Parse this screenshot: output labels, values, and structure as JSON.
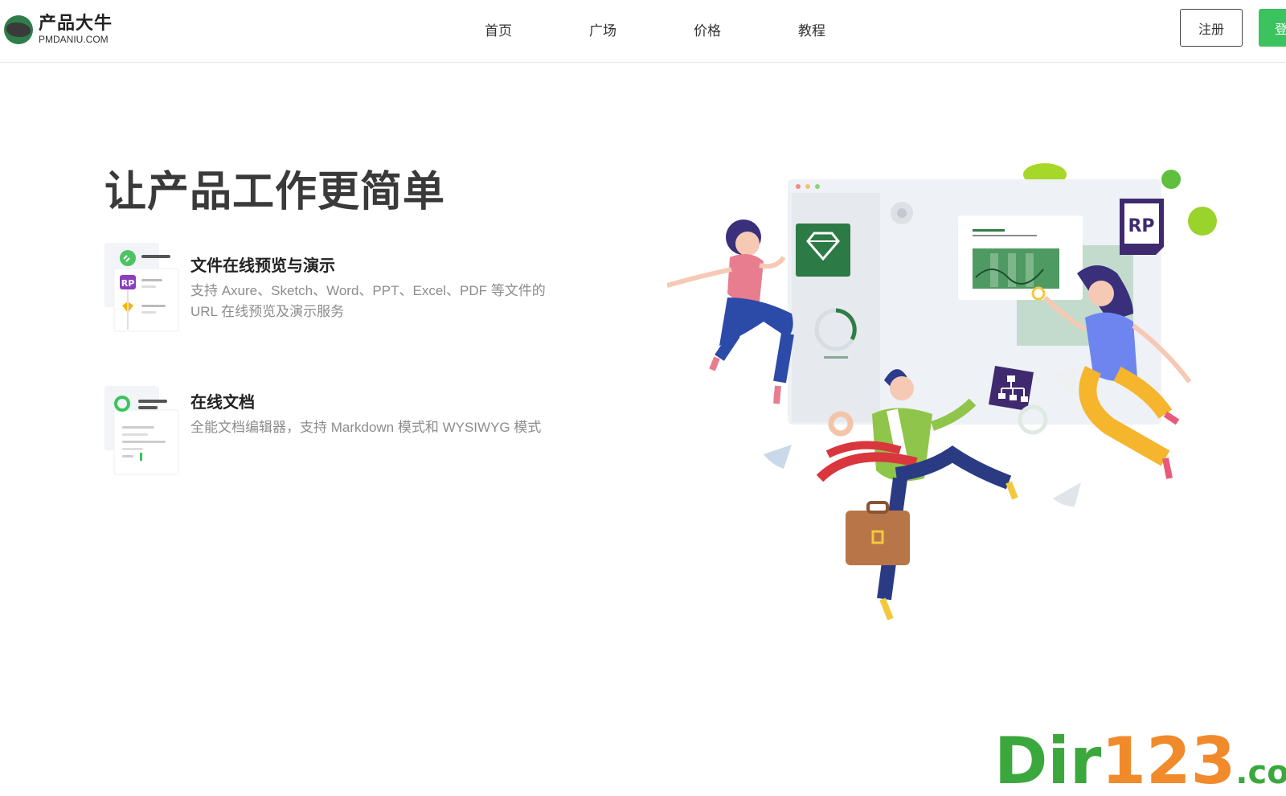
{
  "header": {
    "logo_cn": "产品大牛",
    "logo_en": "PMDANIU.COM",
    "nav": [
      "首页",
      "广场",
      "价格",
      "教程"
    ],
    "register": "注册",
    "login": "登录"
  },
  "hero": {
    "title": "让产品工作更简单",
    "features": [
      {
        "title": "文件在线预览与演示",
        "desc": "支持 Axure、Sketch、Word、PPT、Excel、PDF 等文件的 URL 在线预览及演示服务",
        "icon": "file-preview-icon"
      },
      {
        "title": "在线文档",
        "desc": "全能文档编辑器，支持 Markdown 模式和 WYSIWYG 模式",
        "icon": "online-doc-icon"
      }
    ]
  },
  "illustration": {
    "rp_badge": "RP"
  },
  "watermark": {
    "part1": "Dir",
    "part2": "123",
    "part3": ".com"
  },
  "colors": {
    "brand_green": "#3cc35f",
    "title_gray": "#3a3a3a",
    "desc_gray": "#8c8c8c"
  }
}
